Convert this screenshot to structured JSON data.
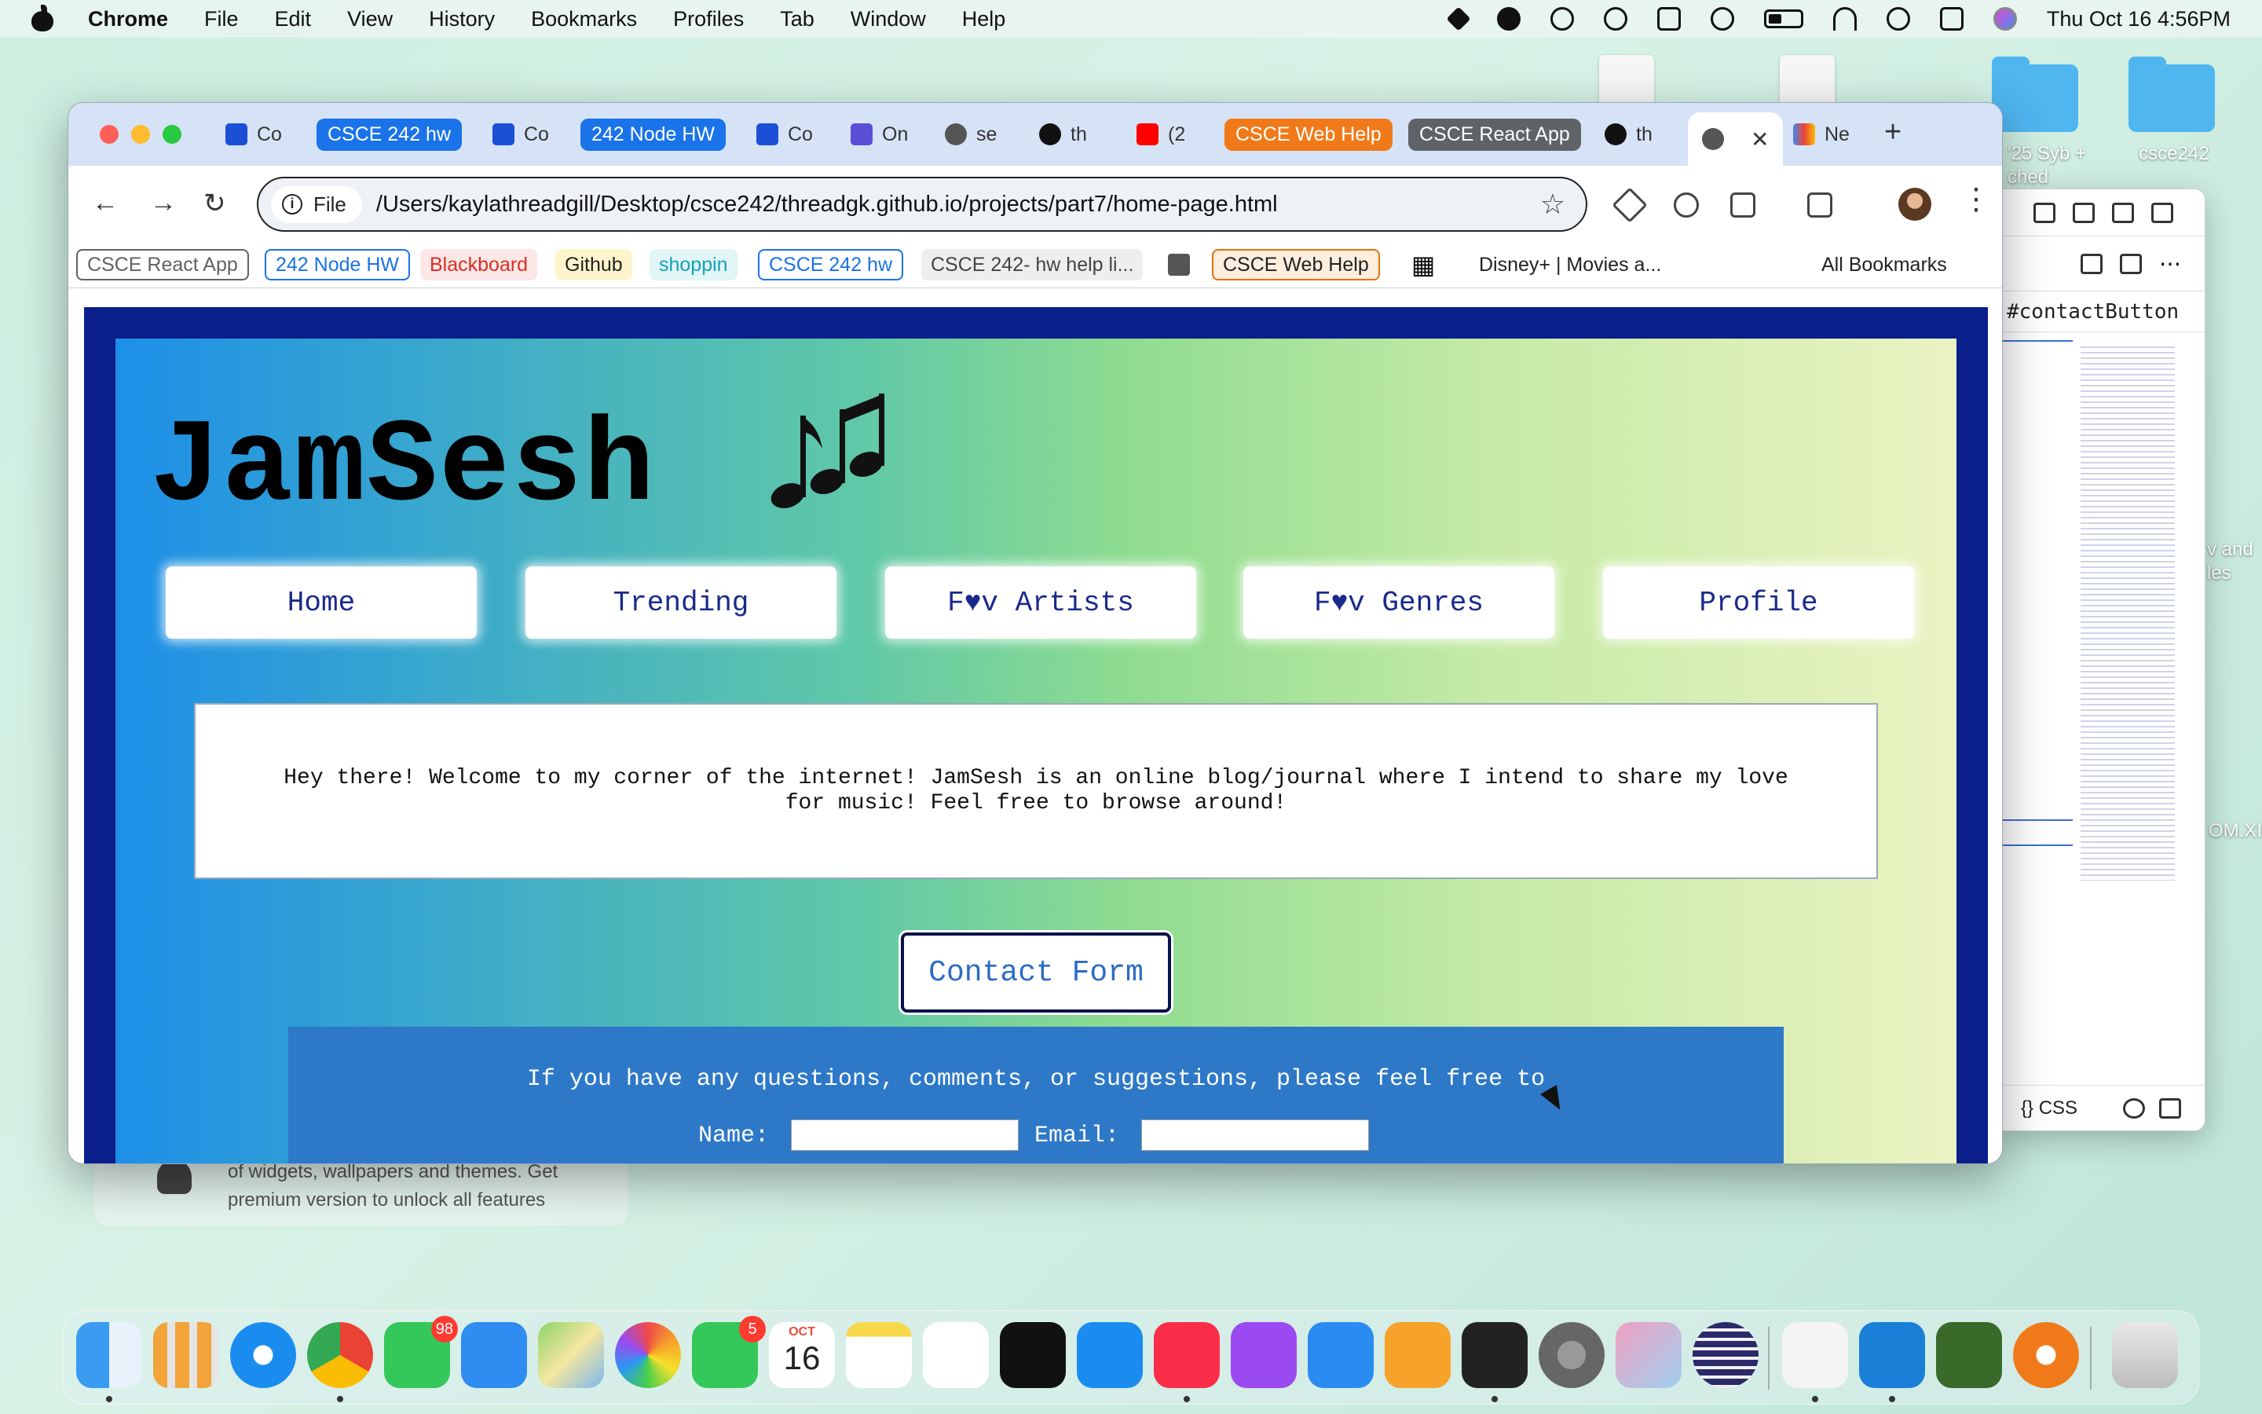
{
  "menubar": {
    "app_name": "Chrome",
    "menus": [
      "File",
      "Edit",
      "View",
      "History",
      "Bookmarks",
      "Profiles",
      "Tab",
      "Window",
      "Help"
    ],
    "clock": "Thu Oct 16  4:56PM"
  },
  "desktop": {
    "folder1_label_line1": "'25 Syb +",
    "folder1_label_line2": "ched",
    "folder2_label": "csce242",
    "side_label1": "v and",
    "side_label2": "les",
    "side_label3": "OM.XI",
    "notification_text": "of widgets, wallpapers and themes. Get premium version to unlock all features"
  },
  "devtools": {
    "selector": "#contactButton",
    "footer_label": "{} CSS"
  },
  "tabs": [
    {
      "label": "Co",
      "fav_color": "#1a4fd6"
    },
    {
      "label": "CSCE 242 hw",
      "pill_color": "#1a73e8"
    },
    {
      "label": "Co",
      "fav_color": "#1a4fd6"
    },
    {
      "label": "242 Node HW",
      "pill_color": "#1a73e8"
    },
    {
      "label": "Co",
      "fav_color": "#1a4fd6"
    },
    {
      "label": "On",
      "fav_color": "#5a4fd6"
    },
    {
      "label": "se",
      "fav_color": "#555555"
    },
    {
      "label": "th",
      "fav_color": "#111111"
    },
    {
      "label": "(2",
      "fav_color": "#ff0000"
    },
    {
      "label": "CSCE Web Help",
      "pill_color": "#f07a1a"
    },
    {
      "label": "CSCE React App",
      "pill_color": "#5f6368"
    },
    {
      "label": "th",
      "fav_color": "#111111"
    },
    {
      "label": "",
      "fav_color": "#555555",
      "active": true
    },
    {
      "label": "Ne",
      "fav_color": "#ea4335"
    }
  ],
  "toolbar": {
    "site_chip": "File",
    "url": "/Users/kaylathreadgill/Desktop/csce242/threadgk.github.io/projects/part7/home-page.html"
  },
  "bookmarks": [
    {
      "label": "CSCE React App",
      "color": "#5f6368",
      "style": "outlined"
    },
    {
      "label": "242 Node HW",
      "color": "#1a73e8",
      "style": "outlined"
    },
    {
      "label": "Blackboard",
      "color": "#d93025",
      "style": "tinted"
    },
    {
      "label": "Github",
      "color": "#222222",
      "style": "yellow"
    },
    {
      "label": "shoppin",
      "color": "#12a4b4",
      "style": "tinted"
    },
    {
      "label": "CSCE 242 hw",
      "color": "#1a73e8",
      "style": "outlined"
    },
    {
      "label": "CSCE 242- hw help li...",
      "color": "#444444",
      "style": "grey"
    },
    {
      "label": "CSCE Web Help",
      "color": "#e8710a",
      "style": "outlined"
    },
    {
      "label": "Disney+ | Movies a...",
      "color": "#222222",
      "style": "plain"
    },
    {
      "label": "All Bookmarks",
      "color": "#222222",
      "style": "plain"
    }
  ],
  "page": {
    "title": "JamSesh",
    "notes_emoji": "🎶",
    "nav": [
      "Home",
      "Trending",
      "F♥v Artists",
      "F♥v Genres",
      "Profile"
    ],
    "welcome": "Hey there! Welcome to my corner of the internet! JamSesh is an online blog/journal where I intend to share my love for music! Feel free to browse around!",
    "contact_button": "Contact Form",
    "contact_intro": "If you have any questions, comments, or suggestions, please feel free to",
    "name_label": "Name:",
    "email_label": "Email:"
  },
  "dock": {
    "messages_badge": "98",
    "facetime_badge": "5",
    "calendar_month": "OCT",
    "calendar_day": "16"
  }
}
